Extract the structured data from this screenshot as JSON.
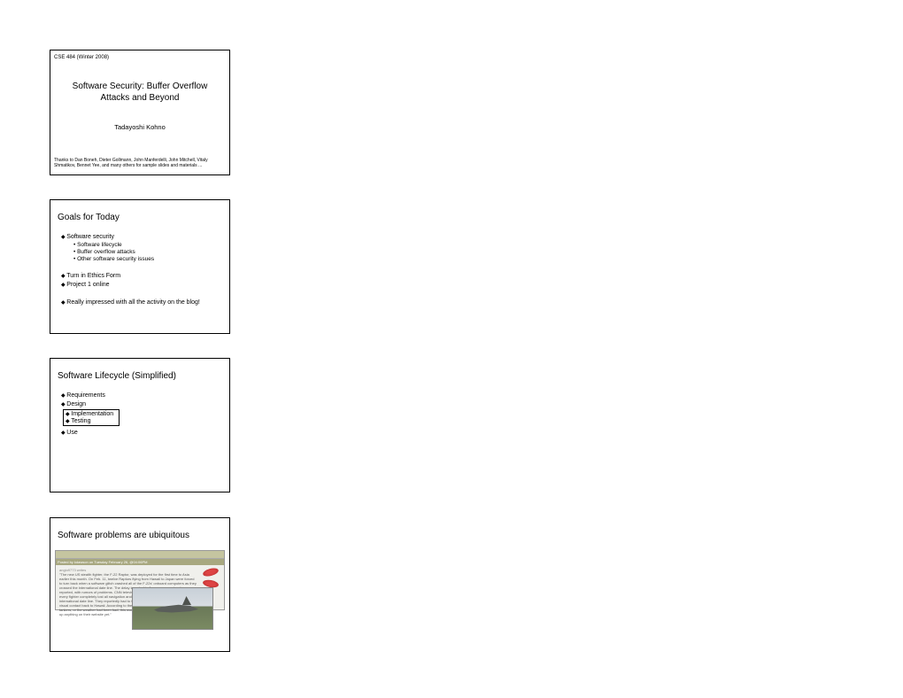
{
  "slide1": {
    "course": "CSE 484 (Winter 2008)",
    "title_line1": "Software Security:  Buffer Overflow",
    "title_line2": "Attacks and Beyond",
    "author": "Tadayoshi Kohno",
    "credits": "Thanks to Dan Boneh, Dieter Gollmann, John Manferdelli, John Mitchell, Vitaly Shmatikov, Bennet Yee, and many others for sample slides and materials ..."
  },
  "slide2": {
    "heading": "Goals for Today",
    "b1a": "Software security",
    "b2a": "Software lifecycle",
    "b2b": "Buffer overflow attacks",
    "b2c": "Other software security issues",
    "b1b": "Turn in Ethics Form",
    "b1c": "Project 1 online",
    "b1d": "Really impressed with all the activity on the blog!"
  },
  "slide3": {
    "heading": "Software Lifecycle (Simplified)",
    "b1a": "Requirements",
    "b1b": "Design",
    "b1c": "Implementation",
    "b1d": "Testing",
    "b1e": "Use"
  },
  "slide4": {
    "heading": "Software problems are ubiquitous",
    "forum_sub": "Posted by kdawson on Tuesday February 26, @04:06PM",
    "forum_line0": "angio9773 writes",
    "forum_body": "\"The new US stealth fighter, the F-22 Raptor, was deployed for the first time to Asia earlier this month. On Feb. 11, twelve Raptors flying from Hawaii to Japan were forced to turn back when a software glitch crashed all of the F-22s' onboard computers as they crossed the international date line. The delay in arrival in Japan was previously reported, with rumors of problems. CNN television, however, this morning reported that every fighter completely lost all navigation and communications when they crossed the international date line. They reportedly had to turn around and follow their tankers by visual contact back to Hawaii. According to the CNN story, if they had not been with their tankers, or the weather had been bad, this would have been serious. CNN has not put up anything on their website yet.\""
  }
}
